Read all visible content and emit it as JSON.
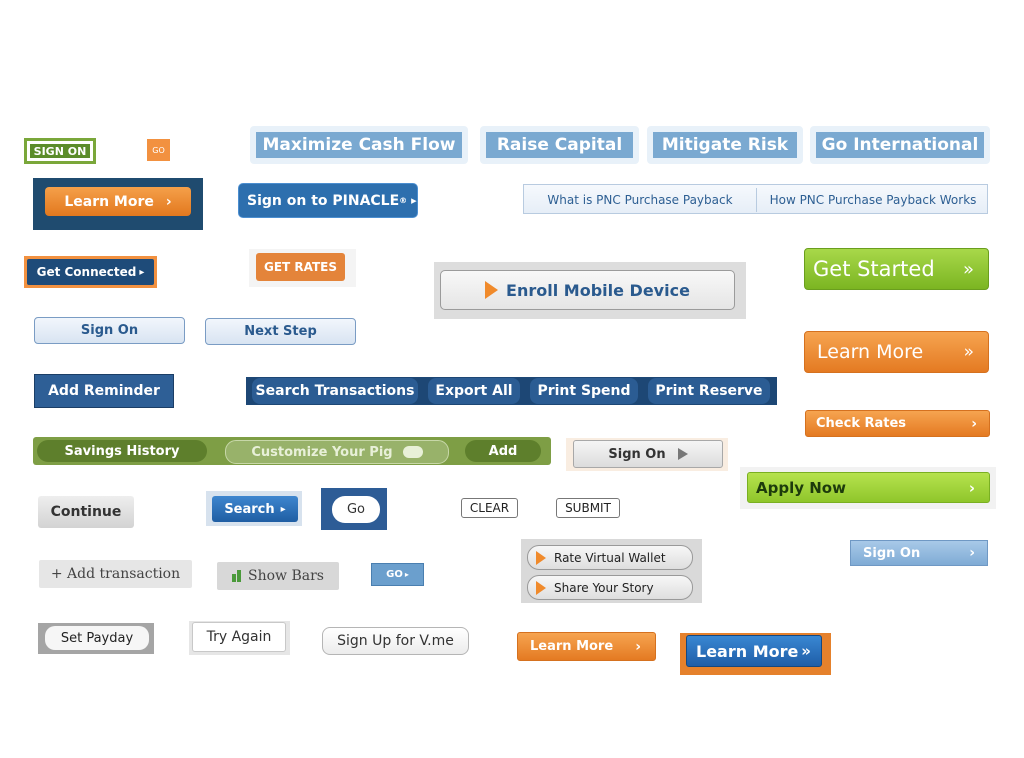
{
  "buttons": {
    "sign_on_green": "SIGN ON",
    "go_orange": "GO",
    "top_tabs": [
      "Maximize Cash Flow",
      "Raise Capital",
      "Mitigate Risk",
      "Go International"
    ],
    "learn_more_dark": "Learn More",
    "sign_on_pinacle": "Sign on to PINACLE",
    "registered_mark": "®",
    "pnc_tabs": [
      "What is PNC Purchase Payback",
      "How PNC Purchase Payback Works"
    ],
    "get_connected": "Get Connected",
    "get_rates": "GET RATES",
    "enroll_mobile": "Enroll Mobile Device",
    "get_started": "Get Started",
    "sign_on_blue": "Sign On",
    "next_step": "Next Step",
    "learn_more_orange": "Learn More",
    "add_reminder": "Add Reminder",
    "transaction_bar": [
      "Search Transactions",
      "Export All",
      "Print Spend",
      "Print Reserve"
    ],
    "check_rates": "Check Rates",
    "savings_history": "Savings History",
    "customize_pig": "Customize Your Pig",
    "add": "Add",
    "sign_on_grey": "Sign On",
    "apply_now": "Apply Now",
    "continue": "Continue",
    "search": "Search",
    "go_white": "Go",
    "clear": "CLEAR",
    "submit": "SUBMIT",
    "sign_on_lightblue": "Sign On",
    "add_transaction": "+ Add transaction",
    "show_bars": "Show Bars",
    "go_small": "GO",
    "rate_wallet": "Rate Virtual Wallet",
    "share_story": "Share Your Story",
    "set_payday": "Set Payday",
    "try_again": "Try Again",
    "sign_up_vme": "Sign Up for V.me",
    "learn_more_small": "Learn More",
    "learn_more_blue": "Learn More"
  },
  "glyphs": {
    "double_chevron": "»",
    "chevron": "›",
    "small_triangle": "▸"
  },
  "colors": {
    "orange": "#e47a22",
    "green": "#7bb522",
    "navy": "#1e4b79",
    "blue": "#2d6fae"
  }
}
